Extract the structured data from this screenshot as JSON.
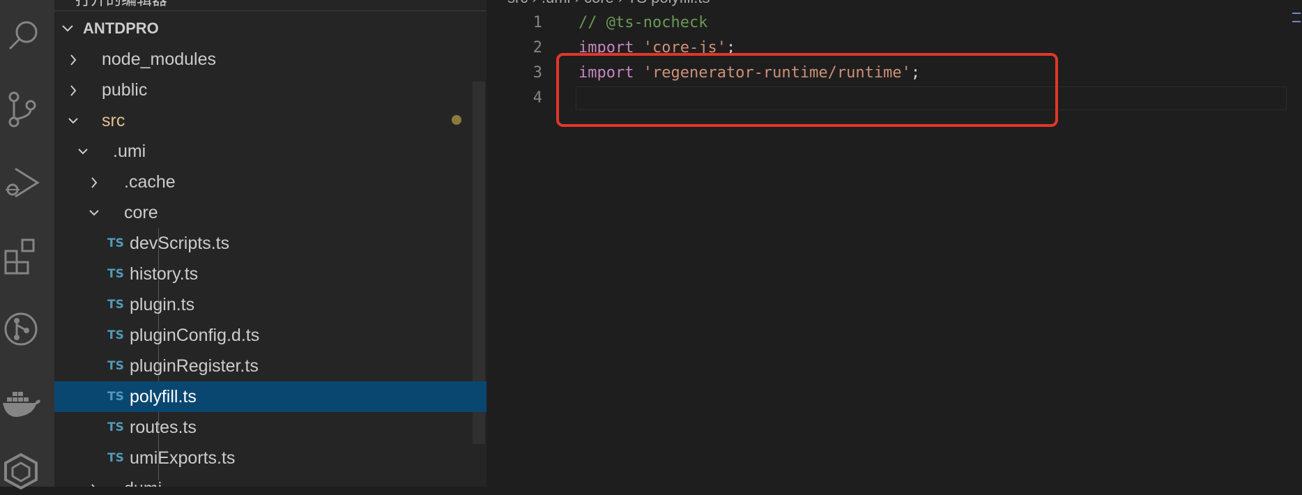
{
  "window": {
    "top_cut_text": "打开的编辑器"
  },
  "activity_bar": {
    "icons": [
      "search-icon",
      "source-control-icon",
      "run-debug-icon",
      "extensions-icon",
      "git-graph-icon",
      "docker-icon",
      "remote-icon"
    ]
  },
  "explorer": {
    "section_title": "ANTDPRO",
    "items": [
      {
        "label": "node_modules",
        "type": "folder",
        "expanded": false
      },
      {
        "label": "public",
        "type": "folder",
        "expanded": false
      },
      {
        "label": "src",
        "type": "folder",
        "expanded": true,
        "modified": true
      },
      {
        "label": ".umi",
        "type": "folder",
        "expanded": true
      },
      {
        "label": ".cache",
        "type": "folder",
        "expanded": false
      },
      {
        "label": "core",
        "type": "folder",
        "expanded": true
      },
      {
        "label": "devScripts.ts",
        "type": "ts"
      },
      {
        "label": "history.ts",
        "type": "ts"
      },
      {
        "label": "plugin.ts",
        "type": "ts"
      },
      {
        "label": "pluginConfig.d.ts",
        "type": "ts"
      },
      {
        "label": "pluginRegister.ts",
        "type": "ts"
      },
      {
        "label": "polyfill.ts",
        "type": "ts",
        "selected": true
      },
      {
        "label": "routes.ts",
        "type": "ts"
      },
      {
        "label": "umiExports.ts",
        "type": "ts"
      },
      {
        "label": "dumi",
        "type": "folder",
        "expanded": false
      }
    ],
    "ts_badge": "TS"
  },
  "editor": {
    "breadcrumb": "src › .umi › core › TS polyfill.ts",
    "lines": [
      {
        "num": "1",
        "parts": [
          {
            "t": "// @ts-nocheck",
            "c": "comment"
          }
        ]
      },
      {
        "num": "2",
        "parts": [
          {
            "t": "import",
            "c": "keyword"
          },
          {
            "t": " ",
            "c": "punct"
          },
          {
            "t": "'core-js'",
            "c": "string"
          },
          {
            "t": ";",
            "c": "punct"
          }
        ]
      },
      {
        "num": "3",
        "parts": [
          {
            "t": "import",
            "c": "keyword"
          },
          {
            "t": " ",
            "c": "punct"
          },
          {
            "t": "'regenerator-runtime/runtime'",
            "c": "string"
          },
          {
            "t": ";",
            "c": "punct"
          }
        ]
      },
      {
        "num": "4",
        "parts": []
      }
    ],
    "highlight_color": "#e0372a"
  }
}
